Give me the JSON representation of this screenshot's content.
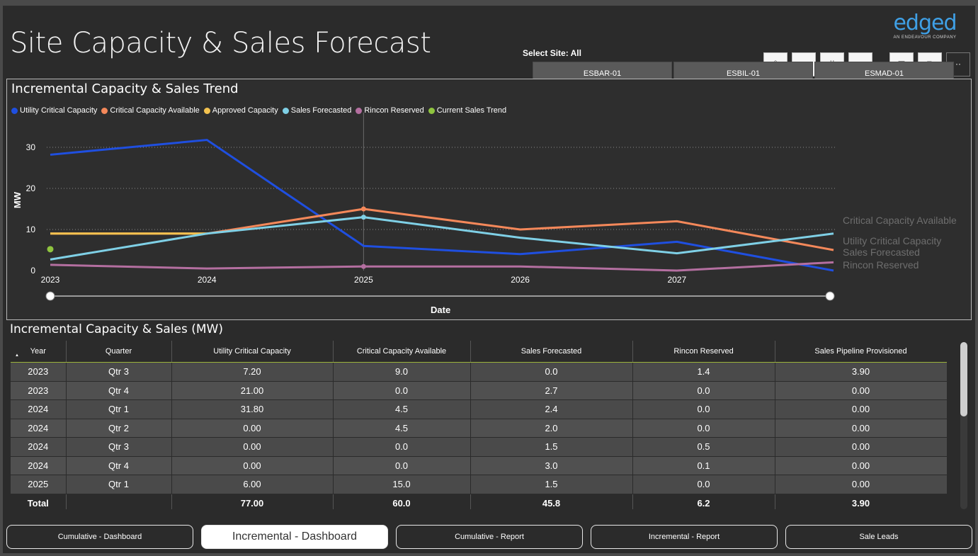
{
  "header": {
    "title": "Site Capacity & Sales Forecast",
    "logo_text": "edged",
    "logo_subtext": "AN ENDEAVOUR COMPANY",
    "select_site_label": "Select Site: All"
  },
  "site_slicer": [
    "ESBAR-01",
    "ESBIL-01",
    "ESMAD-01"
  ],
  "chart": {
    "title": "Incremental Capacity & Sales Trend",
    "legend": [
      {
        "label": "Utility Critical Capacity",
        "color": "#1f4fe0"
      },
      {
        "label": "Critical Capacity Available",
        "color": "#f4885a"
      },
      {
        "label": "Approved Capacity",
        "color": "#f3c24f"
      },
      {
        "label": "Sales Forecasted",
        "color": "#7fd0e6"
      },
      {
        "label": "Rincon Reserved",
        "color": "#b46fa0"
      },
      {
        "label": "Current Sales Trend",
        "color": "#8fc43f"
      }
    ],
    "end_labels": [
      "Critical Capacity Available",
      "Utility Critical Capacity",
      "Sales Forecasted",
      "Rincon Reserved"
    ]
  },
  "chart_data": {
    "type": "line",
    "title": "Incremental Capacity & Sales Trend",
    "xlabel": "Date",
    "ylabel": "MW",
    "x_ticks": [
      "2023",
      "2024",
      "2025",
      "2026",
      "2027"
    ],
    "y_ticks": [
      0,
      10,
      20,
      30
    ],
    "xlim": [
      2023,
      2028
    ],
    "ylim": [
      0,
      35
    ],
    "grid": true,
    "legend_position": "top-left",
    "series": [
      {
        "name": "Utility Critical Capacity",
        "color": "#1f4fe0",
        "x": [
          2023,
          2024,
          2025,
          2026,
          2027,
          2028
        ],
        "y": [
          28.2,
          31.8,
          6.0,
          4.0,
          7.0,
          0.0
        ]
      },
      {
        "name": "Critical Capacity Available",
        "color": "#f4885a",
        "x": [
          2023,
          2024,
          2025,
          2026,
          2027,
          2028
        ],
        "y": [
          9.0,
          9.0,
          15.0,
          10.0,
          12.0,
          5.0
        ]
      },
      {
        "name": "Approved Capacity",
        "color": "#f3c24f",
        "x": [
          2023,
          2024
        ],
        "y": [
          9.0,
          9.0
        ]
      },
      {
        "name": "Sales Forecasted",
        "color": "#7fd0e6",
        "x": [
          2023,
          2024,
          2025,
          2026,
          2027,
          2028
        ],
        "y": [
          2.7,
          9.0,
          13.0,
          8.0,
          4.2,
          9.0
        ]
      },
      {
        "name": "Rincon Reserved",
        "color": "#b46fa0",
        "x": [
          2023,
          2024,
          2025,
          2026,
          2027,
          2028
        ],
        "y": [
          1.4,
          0.5,
          1.0,
          1.0,
          0.0,
          2.0
        ]
      },
      {
        "name": "Current Sales Trend",
        "color": "#8fc43f",
        "x": [
          2023
        ],
        "y": [
          5.2
        ]
      }
    ],
    "marker_x": 2025
  },
  "table": {
    "title": "Incremental Capacity & Sales (MW)",
    "columns": [
      "Year",
      "Quarter",
      "Utility Critical Capacity",
      "Critical Capacity Available",
      "Sales Forecasted",
      "Rincon Reserved",
      "Sales Pipeline Provisioned"
    ],
    "rows": [
      [
        "2023",
        "Qtr 3",
        "7.20",
        "9.0",
        "0.0",
        "1.4",
        "3.90"
      ],
      [
        "2023",
        "Qtr 4",
        "21.00",
        "0.0",
        "2.7",
        "0.0",
        "0.00"
      ],
      [
        "2024",
        "Qtr 1",
        "31.80",
        "4.5",
        "2.4",
        "0.0",
        "0.00"
      ],
      [
        "2024",
        "Qtr 2",
        "0.00",
        "4.5",
        "2.0",
        "0.0",
        "0.00"
      ],
      [
        "2024",
        "Qtr 3",
        "0.00",
        "0.0",
        "1.5",
        "0.5",
        "0.00"
      ],
      [
        "2024",
        "Qtr 4",
        "0.00",
        "0.0",
        "3.0",
        "0.1",
        "0.00"
      ],
      [
        "2025",
        "Qtr 1",
        "6.00",
        "15.0",
        "1.5",
        "0.0",
        "0.00"
      ]
    ],
    "total": [
      "Total",
      "",
      "77.00",
      "60.0",
      "45.8",
      "6.2",
      "3.90"
    ]
  },
  "nav": [
    {
      "label": "Cumulative - Dashboard",
      "active": false
    },
    {
      "label": "Incremental - Dashboard",
      "active": true
    },
    {
      "label": "Cumulative - Report",
      "active": false
    },
    {
      "label": "Incremental - Report",
      "active": false
    },
    {
      "label": "Sale Leads",
      "active": false
    }
  ]
}
